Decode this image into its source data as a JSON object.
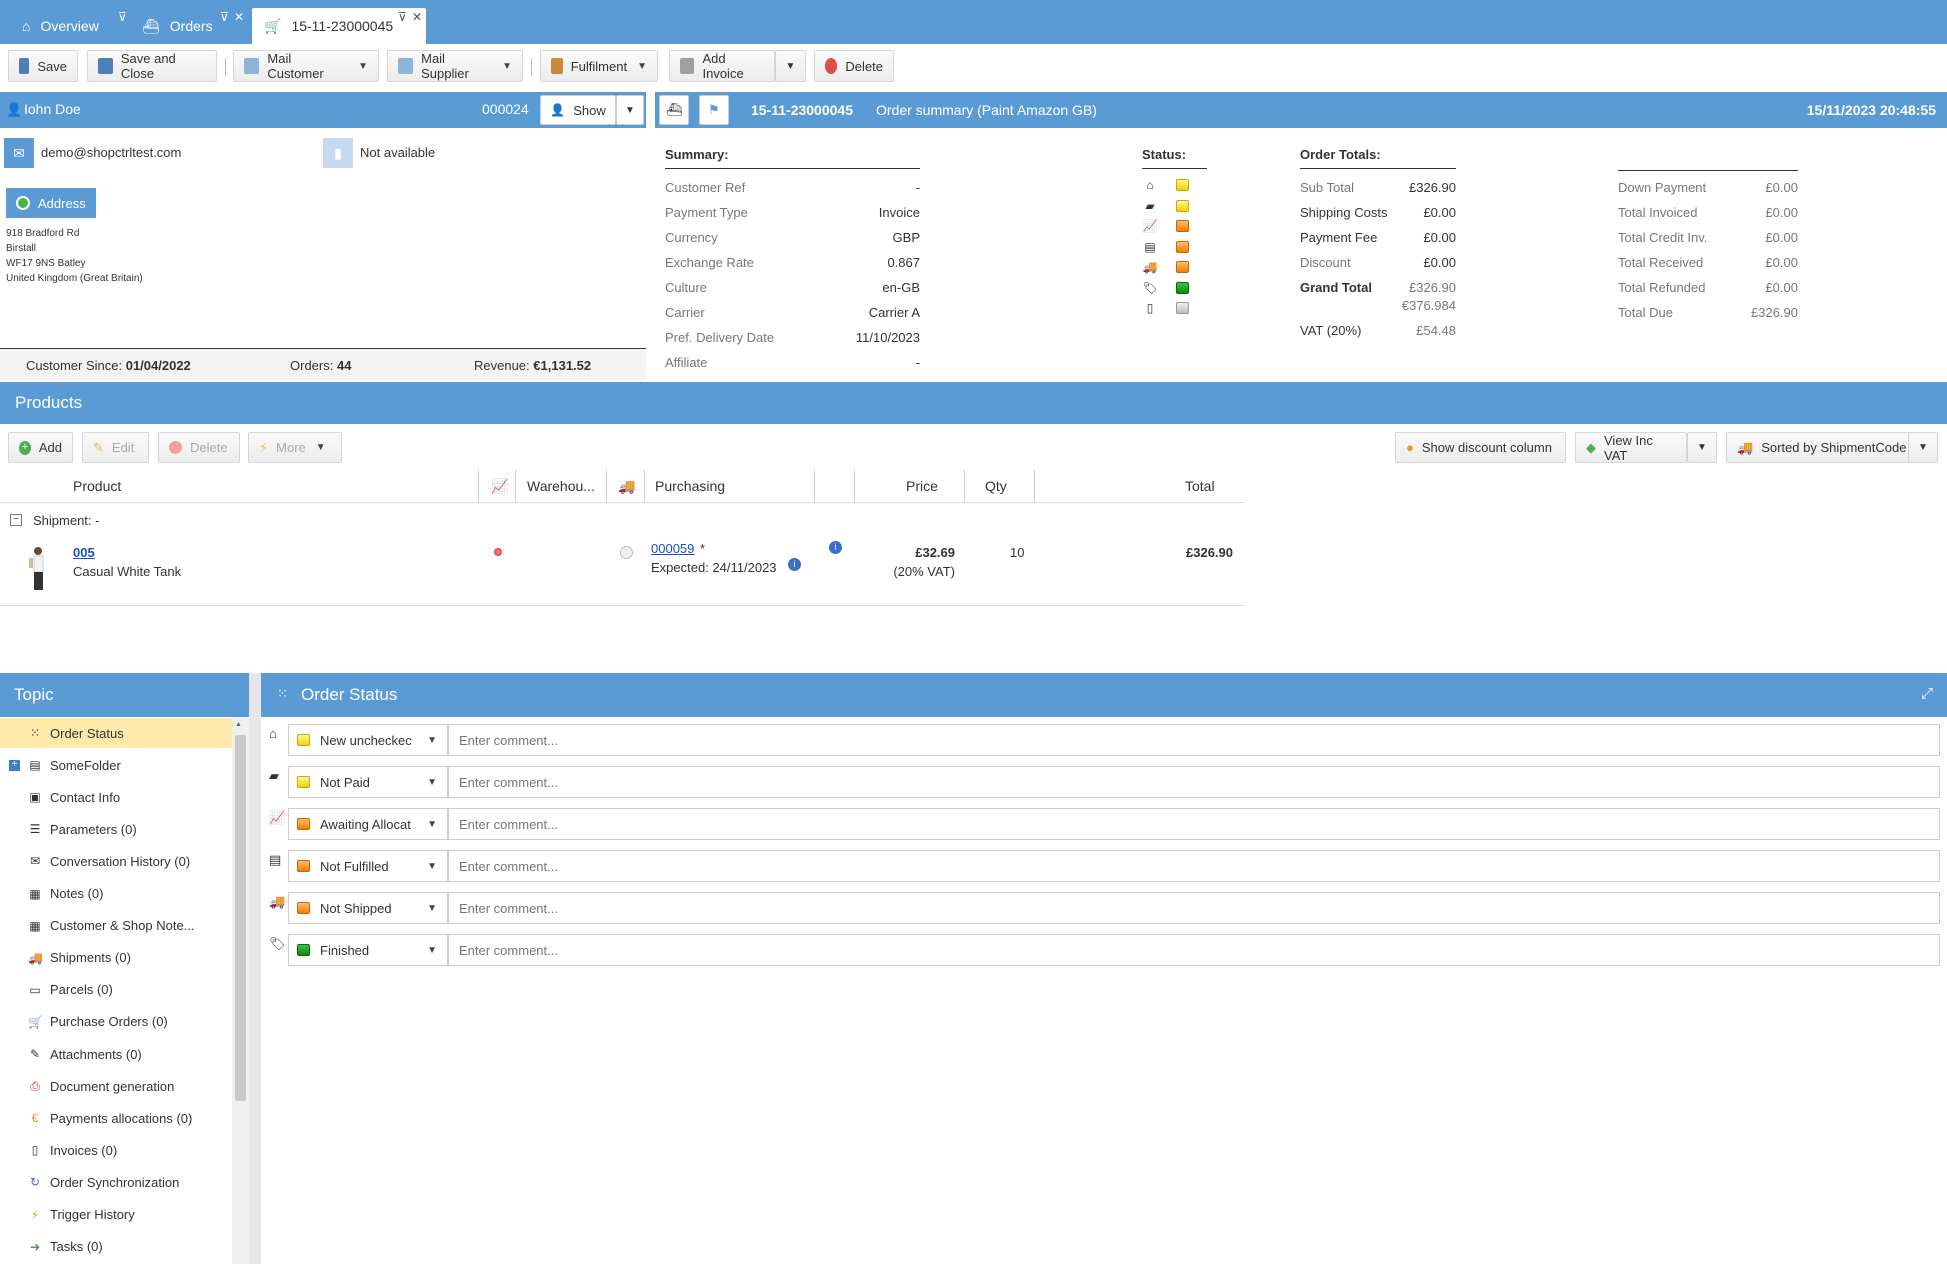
{
  "tabs": [
    {
      "label": "Overview"
    },
    {
      "label": "Orders"
    },
    {
      "label": "15-11-23000045"
    }
  ],
  "toolbar": {
    "save": "Save",
    "save_close": "Save and Close",
    "mail_customer": "Mail Customer",
    "mail_supplier": "Mail Supplier",
    "fulfilment": "Fulfilment",
    "add_invoice": "Add Invoice",
    "delete": "Delete"
  },
  "customer": {
    "name": "Iohn Doe",
    "number": "000024",
    "show_label": "Show",
    "email": "demo@shopctrltest.com",
    "phone": "Not available",
    "address_button": "Address",
    "address_lines": [
      "918 Bradford Rd",
      "Birstall",
      "WF17 9NS Batley",
      "United Kingdom (Great Britain)"
    ],
    "since_label": "Customer Since:",
    "since_value": "01/04/2022",
    "orders_label": "Orders:",
    "orders_value": "44",
    "revenue_label": "Revenue:",
    "revenue_value": "€1,131.52"
  },
  "order": {
    "number": "15-11-23000045",
    "title": "Order summary (Paint Amazon GB)",
    "datetime": "15/11/2023 20:48:55"
  },
  "summary": {
    "heading": "Summary:",
    "rows": [
      {
        "label": "Customer Ref",
        "value": "-"
      },
      {
        "label": "Payment Type",
        "value": "Invoice"
      },
      {
        "label": "Currency",
        "value": "GBP"
      },
      {
        "label": "Exchange Rate",
        "value": "0.867"
      },
      {
        "label": "Culture",
        "value": "en-GB"
      },
      {
        "label": "Carrier",
        "value": "Carrier A"
      },
      {
        "label": "Pref. Delivery Date",
        "value": "11/10/2023"
      },
      {
        "label": "Affiliate",
        "value": "-"
      }
    ]
  },
  "status_summary": {
    "heading": "Status:",
    "items": [
      {
        "icon": "home-icon",
        "color": "yellow"
      },
      {
        "icon": "money-icon",
        "color": "yellow"
      },
      {
        "icon": "chart-icon",
        "color": "orange"
      },
      {
        "icon": "box-icon",
        "color": "orange"
      },
      {
        "icon": "truck-icon",
        "color": "orange"
      },
      {
        "icon": "tag-icon",
        "color": "green"
      },
      {
        "icon": "invoice-icon",
        "color": "grey"
      }
    ]
  },
  "totals": {
    "heading": "Order Totals:",
    "sub_total_label": "Sub Total",
    "sub_total": "£326.90",
    "shipping_label": "Shipping Costs",
    "shipping": "£0.00",
    "payment_fee_label": "Payment Fee",
    "payment_fee": "£0.00",
    "discount_label": "Discount",
    "discount": "£0.00",
    "grand_total_label": "Grand Total",
    "grand_total": "£326.90",
    "grand_total_eur": "€376.984",
    "vat_label": "VAT (20%)",
    "vat": "£54.48"
  },
  "payments": {
    "rows": [
      {
        "label": "Down Payment",
        "value": "£0.00"
      },
      {
        "label": "Total Invoiced",
        "value": "£0.00"
      },
      {
        "label": "Total Credit Inv.",
        "value": "£0.00"
      },
      {
        "label": "Total Received",
        "value": "£0.00"
      },
      {
        "label": "Total Refunded",
        "value": "£0.00"
      },
      {
        "label": "Total Due",
        "value": "£326.90"
      }
    ]
  },
  "products": {
    "title": "Products",
    "add": "Add",
    "edit": "Edit",
    "delete": "Delete",
    "more": "More",
    "show_discount": "Show discount column",
    "view_vat": "View Inc VAT",
    "sorted": "Sorted by ShipmentCode",
    "columns": {
      "product": "Product",
      "warehouse": "Warehou...",
      "purchasing": "Purchasing",
      "price": "Price",
      "qty": "Qty",
      "total": "Total"
    },
    "shipment_label": "Shipment: -",
    "rows": [
      {
        "code": "005",
        "name": "Casual White Tank",
        "po": "000059",
        "po_suffix": "*",
        "expected": "Expected: 24/11/2023",
        "price": "£32.69",
        "vat_note": "(20% VAT)",
        "qty": "10",
        "total": "£326.90"
      }
    ]
  },
  "topic": {
    "title": "Topic",
    "items": [
      {
        "label": "Order Status",
        "icon": "grid-icon"
      },
      {
        "label": "SomeFolder",
        "icon": "folder-icon"
      },
      {
        "label": "Contact Info",
        "icon": "contact-icon"
      },
      {
        "label": "Parameters (0)",
        "icon": "list-icon"
      },
      {
        "label": "Conversation History (0)",
        "icon": "mail-icon"
      },
      {
        "label": "Notes (0)",
        "icon": "note-icon"
      },
      {
        "label": "Customer & Shop Note...",
        "icon": "note-icon"
      },
      {
        "label": "Shipments (0)",
        "icon": "truck-icon"
      },
      {
        "label": "Parcels (0)",
        "icon": "parcel-icon"
      },
      {
        "label": "Purchase Orders (0)",
        "icon": "purchase-icon"
      },
      {
        "label": "Attachments (0)",
        "icon": "paperclip-icon"
      },
      {
        "label": "Document generation",
        "icon": "pdf-icon"
      },
      {
        "label": "Payments allocations (0)",
        "icon": "euro-icon"
      },
      {
        "label": "Invoices (0)",
        "icon": "invoice-icon"
      },
      {
        "label": "Order Synchronization",
        "icon": "sync-icon"
      },
      {
        "label": "Trigger History",
        "icon": "lightning-icon"
      },
      {
        "label": "Tasks (0)",
        "icon": "arrow-icon"
      }
    ]
  },
  "order_status": {
    "title": "Order Status",
    "placeholder": "Enter comment...",
    "rows": [
      {
        "icon": "home-icon",
        "color": "yellow",
        "value": "New uncheckec"
      },
      {
        "icon": "money-icon",
        "color": "yellow",
        "value": "Not Paid"
      },
      {
        "icon": "chart-icon",
        "color": "orange",
        "value": "Awaiting Allocat"
      },
      {
        "icon": "box-icon",
        "color": "orange",
        "value": "Not Fulfilled"
      },
      {
        "icon": "truck-icon",
        "color": "orange",
        "value": "Not Shipped"
      },
      {
        "icon": "tag-icon",
        "color": "green",
        "value": "Finished"
      }
    ]
  },
  "colors": {
    "accent": "#5b9bd5",
    "selected": "#fde9a9"
  }
}
